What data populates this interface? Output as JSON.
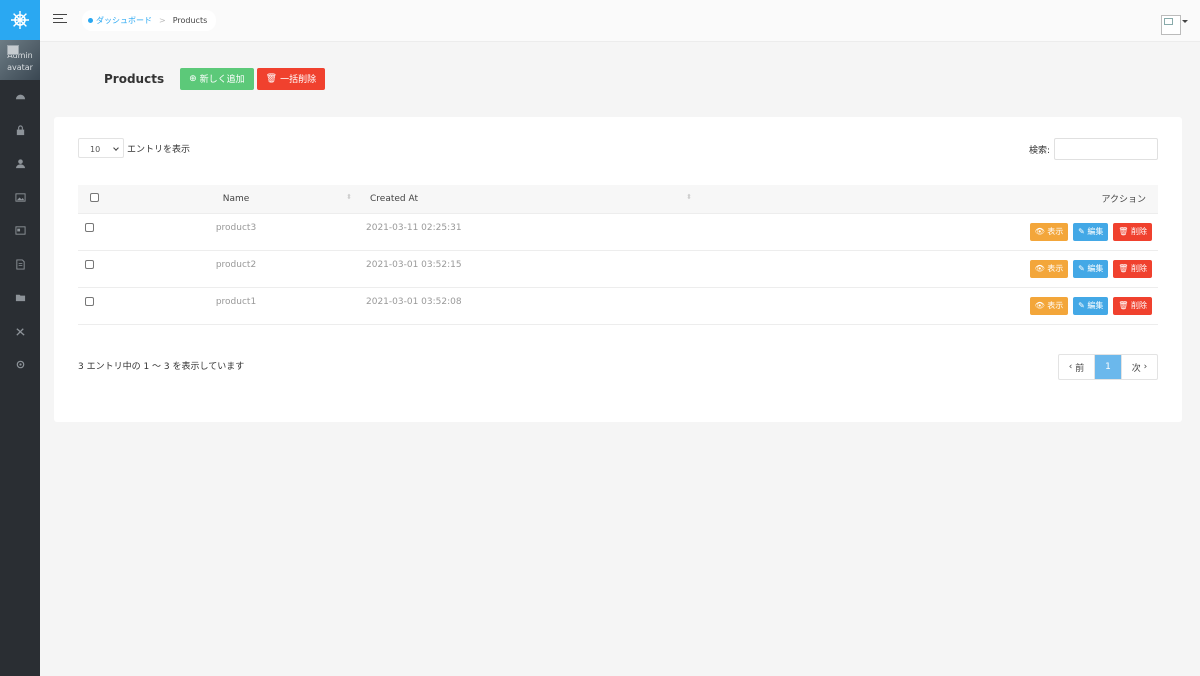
{
  "sidebar": {
    "avatar_alt": "Admin avatar",
    "icons": [
      "dashboard-icon",
      "lock-icon",
      "user-icon",
      "image-icon",
      "id-card-icon",
      "document-icon",
      "folder-icon",
      "tools-icon",
      "settings-icon"
    ]
  },
  "topbar": {
    "breadcrumb_home": "ダッシュボード",
    "breadcrumb_sep": ">",
    "breadcrumb_current": "Products"
  },
  "header": {
    "title": "Products",
    "add_label": "新しく追加",
    "bulk_delete_label": "一括削除"
  },
  "table_controls": {
    "length_value": "10",
    "length_label": "エントリを表示",
    "search_label": "検索:",
    "search_value": ""
  },
  "table": {
    "columns": [
      "Name",
      "Created At",
      "アクション"
    ],
    "rows": [
      {
        "name": "product3",
        "created_at": "2021-03-11 02:25:31"
      },
      {
        "name": "product2",
        "created_at": "2021-03-01 03:52:15"
      },
      {
        "name": "product1",
        "created_at": "2021-03-01 03:52:08"
      }
    ],
    "actions": {
      "show": "表示",
      "edit": "編集",
      "delete": "削除"
    }
  },
  "footer": {
    "info": "3 エントリ中の 1 〜 3 を表示しています",
    "prev": "前",
    "page": "1",
    "next": "次"
  },
  "colors": {
    "brand": "#2aa8f2",
    "sidebar": "#2a2e33",
    "add_button": "#5cc979",
    "danger": "#f0412e",
    "show_button": "#f3a63a",
    "edit_button": "#43a8e6",
    "active_page": "#6bb8ec"
  }
}
